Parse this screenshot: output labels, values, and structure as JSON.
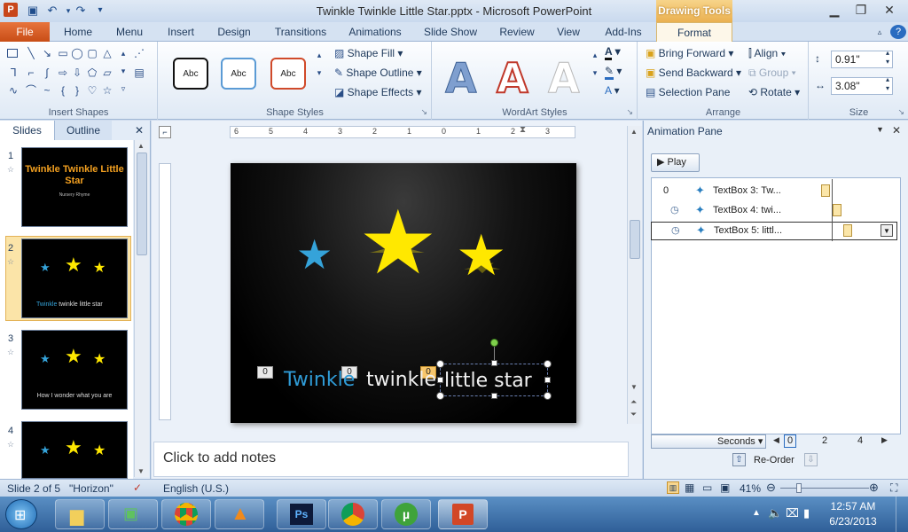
{
  "window": {
    "title": "Twinkle Twinkle Little Star.pptx - Microsoft PowerPoint",
    "contextual_tab": "Drawing Tools"
  },
  "tabs": [
    "File",
    "Home",
    "Menu",
    "Insert",
    "Design",
    "Transitions",
    "Animations",
    "Slide Show",
    "Review",
    "View",
    "Add-Ins",
    "Format"
  ],
  "ribbon": {
    "groups": {
      "insert_shapes": "Insert Shapes",
      "shape_styles": "Shape Styles",
      "wordart_styles": "WordArt Styles",
      "arrange": "Arrange",
      "size": "Size"
    },
    "shape_fill": "Shape Fill",
    "shape_outline": "Shape Outline",
    "shape_effects": "Shape Effects",
    "style_sample": "Abc",
    "bring_forward": "Bring Forward",
    "send_backward": "Send Backward",
    "selection_pane": "Selection Pane",
    "align": "Align",
    "group": "Group",
    "rotate": "Rotate",
    "height": "0.91\"",
    "width": "3.08\"",
    "wordart_letter": "A"
  },
  "left_pane": {
    "tab_slides": "Slides",
    "tab_outline": "Outline",
    "slide_numbers": [
      "1",
      "2",
      "3",
      "4"
    ],
    "thumb1_title": "Twinkle Twinkle Little Star",
    "thumb1_sub": "Nursery Rhyme",
    "thumb2_caption_a": "Twinkle",
    "thumb2_caption_b": "twinkle  little star",
    "thumb3_caption": "How I wonder what you are"
  },
  "ruler": {
    "labels": [
      "6",
      "5",
      "4",
      "3",
      "2",
      "1",
      "0",
      "1",
      "2",
      "3"
    ]
  },
  "slide": {
    "word1": "Twinkle",
    "word2": "twinkle",
    "word3": "little star",
    "tag1": "0",
    "tag2": "0",
    "tag3": "0"
  },
  "notes": {
    "placeholder": "Click to add notes"
  },
  "animation_pane": {
    "title": "Animation Pane",
    "play": "Play",
    "rows": [
      {
        "index": "0",
        "label": "TextBox 3: Tw..."
      },
      {
        "index": "",
        "label": "TextBox 4: twi..."
      },
      {
        "index": "",
        "label": "TextBox 5: littl..."
      }
    ],
    "timeline_unit": "Seconds",
    "timeline_ticks": [
      "0",
      "2",
      "4"
    ],
    "reorder": "Re-Order"
  },
  "status": {
    "slide": "Slide 2 of 5",
    "theme": "\"Horizon\"",
    "language": "English (U.S.)",
    "zoom": "41%"
  },
  "taskbar": {
    "time": "12:57 AM",
    "date": "6/23/2013"
  },
  "colors": {
    "accent_file": "#d4561f",
    "star_yellow": "#ffe800",
    "star_blue": "#35a3d9",
    "word_blue": "#2f9bd6",
    "taskbar": "#3a6da8"
  }
}
